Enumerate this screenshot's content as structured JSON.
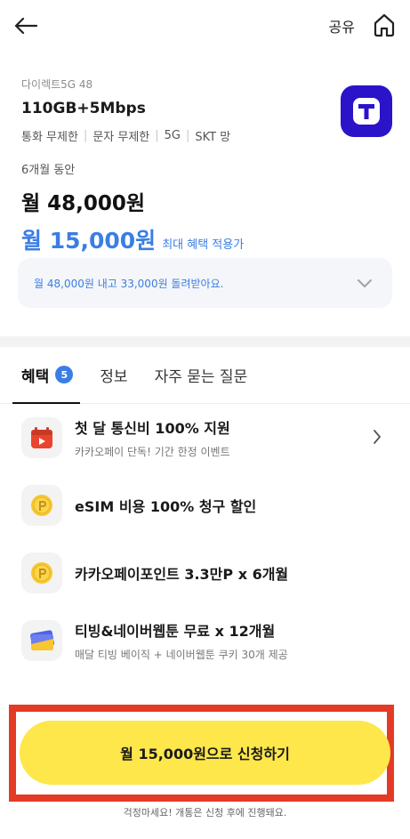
{
  "header": {
    "share_label": "공유",
    "back_icon": "arrow-left-icon",
    "home_icon": "home-icon"
  },
  "plan": {
    "subtitle": "다이렉트5G 48",
    "name": "110GB+5Mbps",
    "tags": [
      "통화 무제한",
      "문자 무제한",
      "5G",
      "SKT 망"
    ],
    "carrier_logo": "T",
    "brand_color": "#2a13c9"
  },
  "price": {
    "period": "6개월 동안",
    "monthly": "월 48,000원",
    "benefit_price": "월 15,000원",
    "benefit_note": "최대 혜택 적용가",
    "accent_color": "#3b7ee3"
  },
  "refund": {
    "text": "월 48,000원 내고 33,000원 돌려받아요."
  },
  "tabs": [
    {
      "label": "혜택",
      "badge": "5",
      "active": true
    },
    {
      "label": "정보",
      "active": false
    },
    {
      "label": "자주 묻는 질문",
      "active": false
    }
  ],
  "benefits": [
    {
      "title": "첫 달 통신비 100% 지원",
      "desc": "카카오페이 단독! 기간 한정 이벤트",
      "icon": "video-calendar-icon"
    },
    {
      "title": "eSIM 비용 100% 청구 할인",
      "desc": "",
      "icon": "point-coin-icon"
    },
    {
      "title": "카카오페이포인트 3.3만P x 6개월",
      "desc": "",
      "icon": "point-coin-icon"
    },
    {
      "title": "티빙&네이버웹툰 무료 x 12개월",
      "desc": "매달 티빙 베이직 + 네이버웹툰 쿠키 30개 제공",
      "icon": "ticket-card-icon"
    }
  ],
  "cta": {
    "label": "월 15,000원으로 신청하기",
    "color": "#fde74a",
    "highlight_color": "#e33b25"
  },
  "notice": "걱정마세요! 개통은 신청 후에 진행돼요."
}
